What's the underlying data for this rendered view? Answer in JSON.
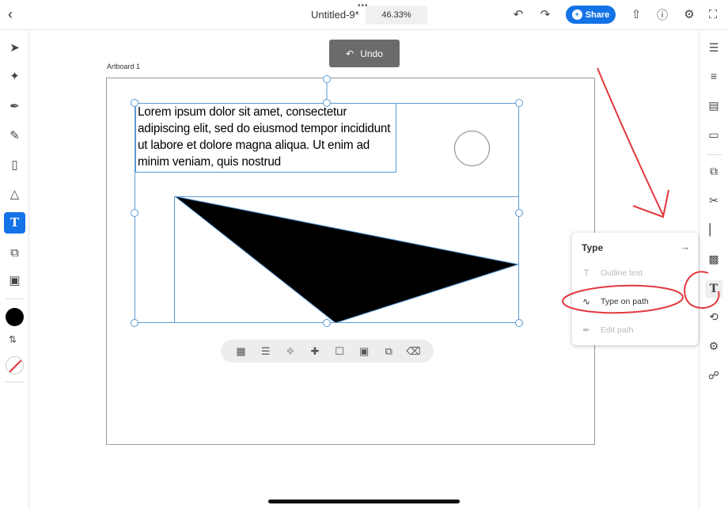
{
  "topbar": {
    "back_icon": "chevron-left-icon",
    "menu_dots": "•••",
    "doc_title": "Untitled-9*",
    "zoom": "46.33%",
    "share_label": "Share",
    "share_avatar_initial": "+"
  },
  "left_toolbar": {
    "tools": [
      "select",
      "direct-select",
      "pen",
      "pencil",
      "eraser",
      "shapes",
      "type",
      "crop",
      "image"
    ],
    "type_glyph": "T",
    "swap_glyph": "⇅",
    "fill_color": "#000000"
  },
  "right_toolbar": {
    "tools": [
      "layers",
      "properties",
      "libraries",
      "comments",
      "arrange",
      "path-ops",
      "align",
      "repeat",
      "type",
      "path",
      "settings",
      "link"
    ]
  },
  "canvas": {
    "artboard_label": "Artboard 1",
    "undo_label": "Undo",
    "lorem_text": "Lorem ipsum dolor sit amet, consectetur adipiscing elit, sed do eiusmod tempor incididunt ut labore et dolore magna aliqua. Ut enim ad minim veniam, quis nostrud",
    "triangle_color": "#000000",
    "selection_color": "#5b9bd5"
  },
  "action_bar": {
    "items": [
      "pattern",
      "align-lines",
      "stack",
      "move",
      "unlock",
      "group",
      "duplicate",
      "delete"
    ]
  },
  "type_popover": {
    "title": "Type",
    "items": [
      {
        "label": "Outline text",
        "enabled": false
      },
      {
        "label": "Type on path",
        "enabled": true
      },
      {
        "label": "Edit path",
        "enabled": false
      }
    ]
  },
  "colors": {
    "accent": "#1473e6",
    "annotation": "#e0393e"
  }
}
